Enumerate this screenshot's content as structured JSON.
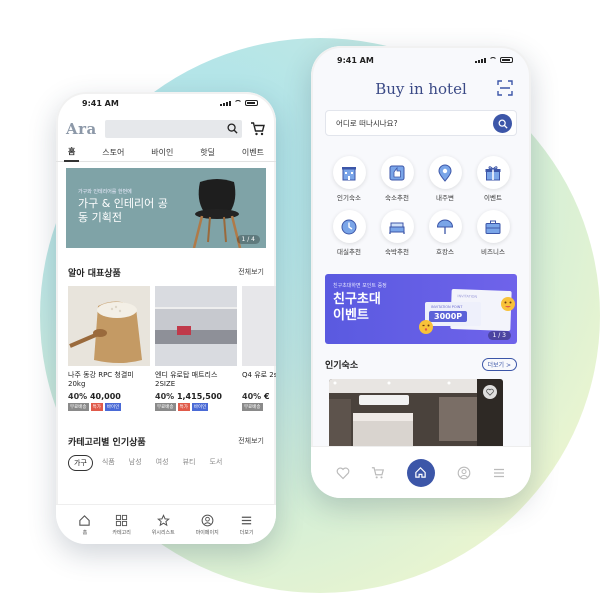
{
  "phone1": {
    "status_time": "9:41 AM",
    "logo": "Ara",
    "tabs": [
      "홈",
      "스토어",
      "바이인",
      "핫딜",
      "이벤트"
    ],
    "banner": {
      "subtitle": "가구와 인테리어를 한번에",
      "title": "가구 & 인테리어 공동 기획전",
      "pager": "1 / 4"
    },
    "section_featured": {
      "title": "알아 대표상품",
      "more": "전체보기"
    },
    "products": [
      {
        "name": "나주 동강 RPC 청결미 20kg",
        "discount": "40%",
        "price": "40,000",
        "tags": [
          "무료배송",
          "특가",
          "바이인"
        ]
      },
      {
        "name": "엔디 유로탑 매트리스 2SIZE",
        "discount": "40%",
        "price": "1,415,500",
        "tags": [
          "무료배송",
          "특가",
          "바이인"
        ]
      },
      {
        "name": "Q4 유로 2size",
        "discount": "40%",
        "price": "€",
        "tags": [
          "무료배송"
        ]
      }
    ],
    "section_category": {
      "title": "카테고리별 인기상품",
      "more": "전체보기"
    },
    "chips": [
      "가구",
      "식품",
      "남성",
      "여성",
      "뷰티",
      "도서"
    ],
    "bottom_nav": [
      "홈",
      "카테고리",
      "위시리스트",
      "마이페이지",
      "더보기"
    ]
  },
  "phone2": {
    "status_time": "9:41 AM",
    "title": "Buy in hotel",
    "search_placeholder": "어디로 떠나시나요?",
    "categories": [
      "인기숙소",
      "숙소추천",
      "내주변",
      "이벤트",
      "대실추천",
      "숙박추천",
      "호캉스",
      "비즈니스"
    ],
    "banner": {
      "subtitle": "친구초대하면 포인트 증정",
      "title_line1": "친구초대",
      "title_line2": "이벤트",
      "ticket_label": "INVITATION POINT",
      "ticket_value": "3000P",
      "envelope_text": "INVITATION",
      "pager": "1 / 3"
    },
    "section_popular": {
      "title": "인기숙소",
      "more": "더보기 >"
    }
  },
  "colors": {
    "accent_blue": "#3c56a8",
    "banner_purple": "#5a5ae0",
    "banner_teal": "#7fa3a7",
    "tag_gray": "#8a8a8a",
    "tag_red": "#e05a4a",
    "tag_blue": "#4a6ad6"
  }
}
